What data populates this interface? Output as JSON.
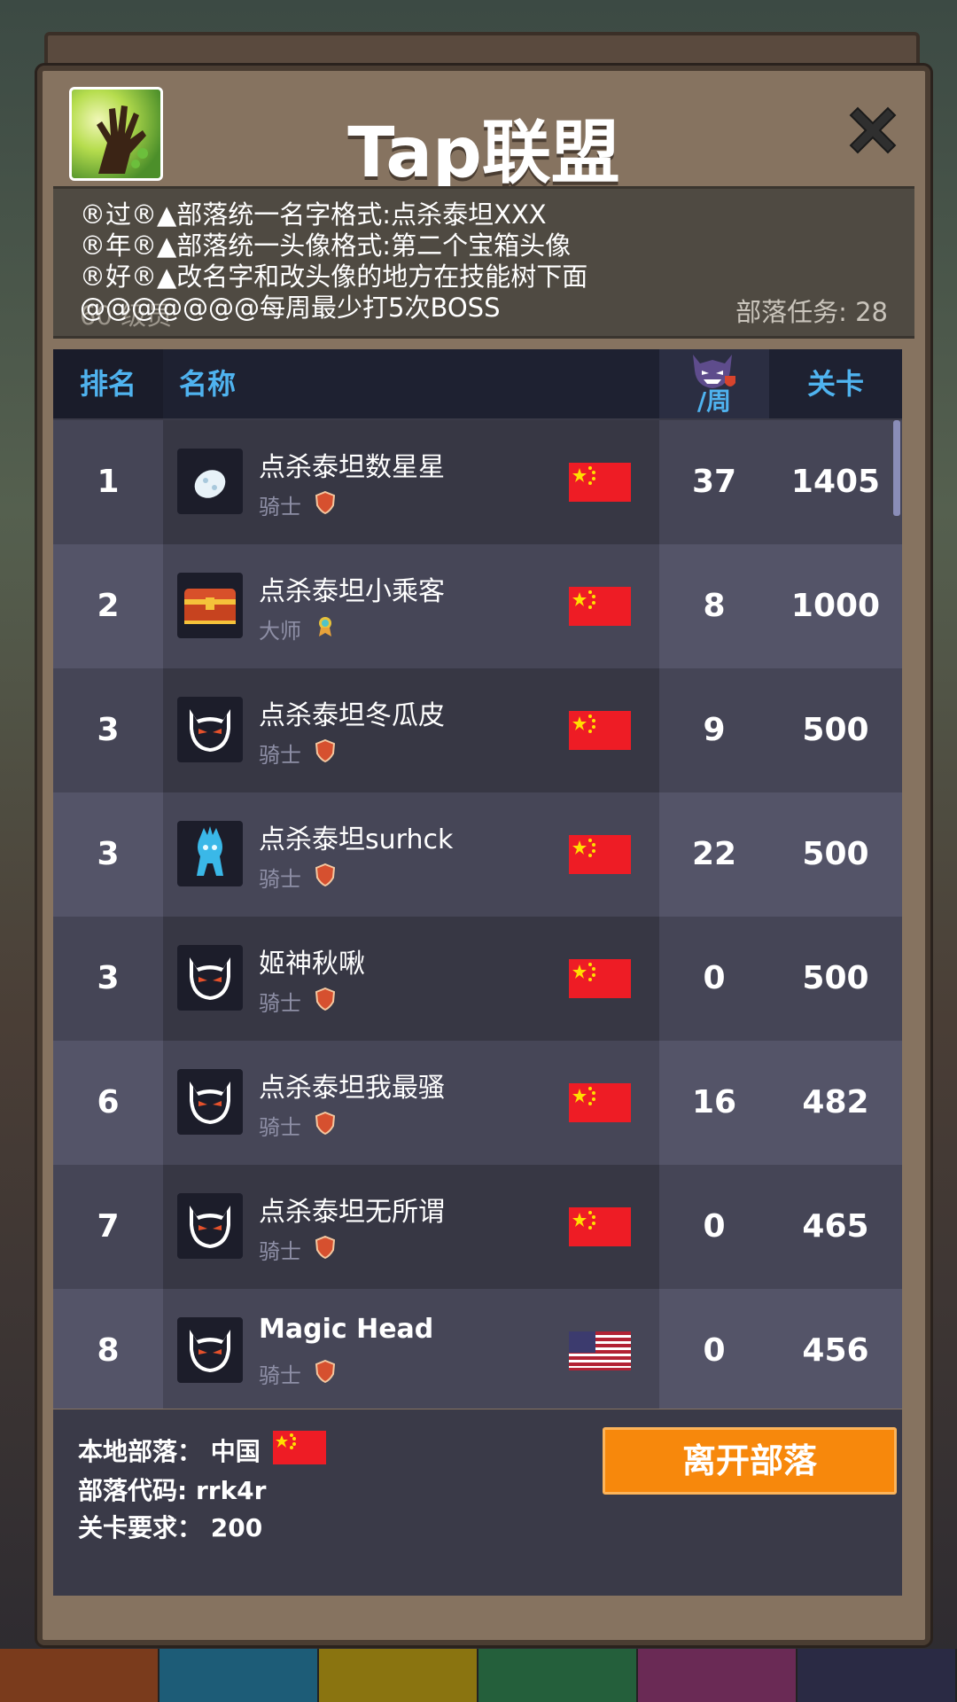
{
  "header": {
    "title": "Tap联盟"
  },
  "notice": {
    "lines": [
      "®过®▲部落统一名字格式:点杀泰坦XXX",
      "®年®▲部落统一头像格式:第二个宝箱头像",
      "®好®▲改名字和改头像的地方在技能树下面",
      "@@@@@@@每周最少打5次BOSS"
    ],
    "ghost": "60 级员",
    "task_label": "部落任务: 28"
  },
  "table": {
    "headers": {
      "rank": "排名",
      "name": "名称",
      "week": "/周",
      "level": "关卡"
    },
    "rows": [
      {
        "rank": "1",
        "name": "点杀泰坦数星星",
        "role": "骑士",
        "week": "37",
        "level": "1405",
        "avatar": "egg-icon",
        "flag": "cn"
      },
      {
        "rank": "2",
        "name": "点杀泰坦小乘客",
        "role": "大师",
        "week": "8",
        "level": "1000",
        "avatar": "treasure-chest-icon",
        "flag": "cn"
      },
      {
        "rank": "3",
        "name": "点杀泰坦冬瓜皮",
        "role": "骑士",
        "week": "9",
        "level": "500",
        "avatar": "demon-face-icon",
        "flag": "cn"
      },
      {
        "rank": "3",
        "name": "点杀泰坦surhck",
        "role": "骑士",
        "week": "22",
        "level": "500",
        "avatar": "ice-spirit-icon",
        "flag": "cn"
      },
      {
        "rank": "3",
        "name": "姬神秋啾",
        "role": "骑士",
        "week": "0",
        "level": "500",
        "avatar": "demon-face-icon",
        "flag": "cn"
      },
      {
        "rank": "6",
        "name": "点杀泰坦我最骚",
        "role": "骑士",
        "week": "16",
        "level": "482",
        "avatar": "demon-face-icon",
        "flag": "cn"
      },
      {
        "rank": "7",
        "name": "点杀泰坦无所谓",
        "role": "骑士",
        "week": "0",
        "level": "465",
        "avatar": "demon-face-icon",
        "flag": "cn"
      },
      {
        "rank": "8",
        "name": "Magic Head",
        "role": "骑士",
        "week": "0",
        "level": "456",
        "avatar": "demon-face-icon",
        "flag": "us"
      }
    ]
  },
  "footer": {
    "local_clan": "本地部落： 中国",
    "clan_code": "部落代码: rrk4r",
    "stage_req": "关卡要求： 200",
    "leave_button": "离开部落"
  },
  "colors": {
    "accent_blue": "#4fb3ef",
    "leave_orange": "#f7880c",
    "flag_red": "#ee1c25",
    "flag_yellow": "#ffde00"
  }
}
